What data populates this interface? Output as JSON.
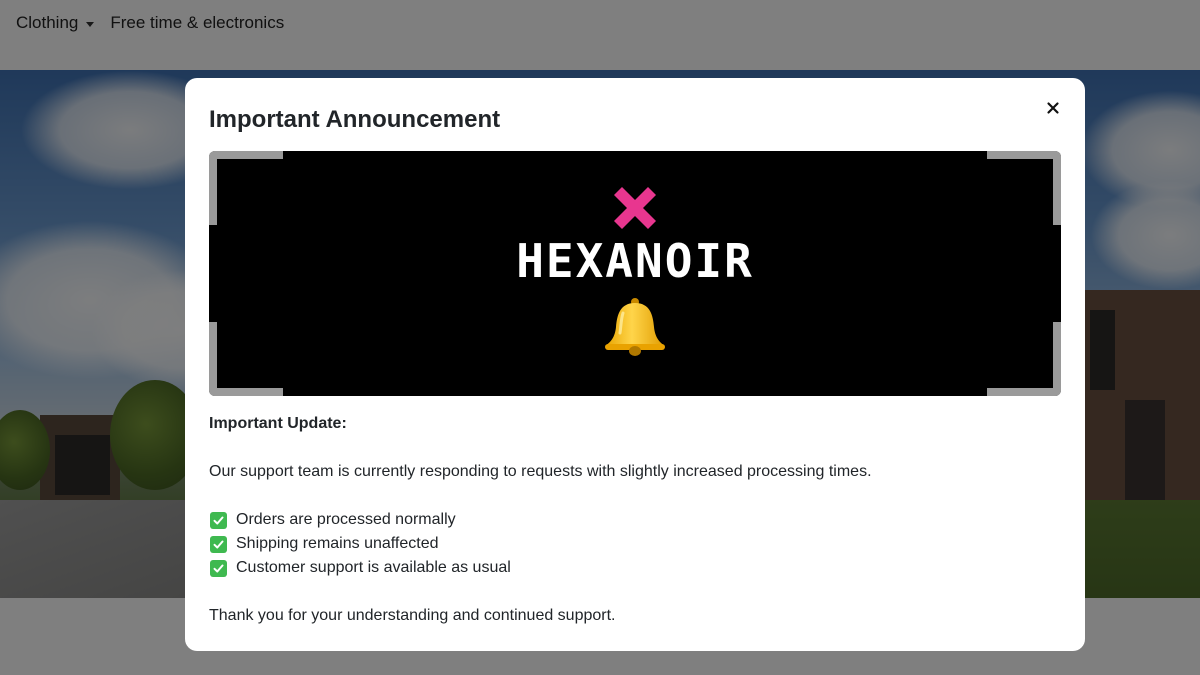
{
  "nav": {
    "items": [
      {
        "label": "Clothing",
        "has_dropdown": true
      },
      {
        "label": "Free time & electronics",
        "has_dropdown": false
      }
    ]
  },
  "modal": {
    "title": "Important Announcement",
    "close_icon": "close-icon",
    "banner": {
      "brand": "HEXANOIR",
      "brand_mark_color": "#e8368f",
      "icon": "bell-icon"
    },
    "heading": "Important Update:",
    "message": "Our support team is currently responding to requests with slightly increased processing times.",
    "checklist": [
      "Orders are processed normally",
      "Shipping remains unaffected",
      "Customer support is available as usual"
    ],
    "closing": "Thank you for your understanding and continued support."
  },
  "colors": {
    "overlay": "rgba(0,0,0,0.5)",
    "check": "#3fb950",
    "banner_bg": "#000000"
  }
}
